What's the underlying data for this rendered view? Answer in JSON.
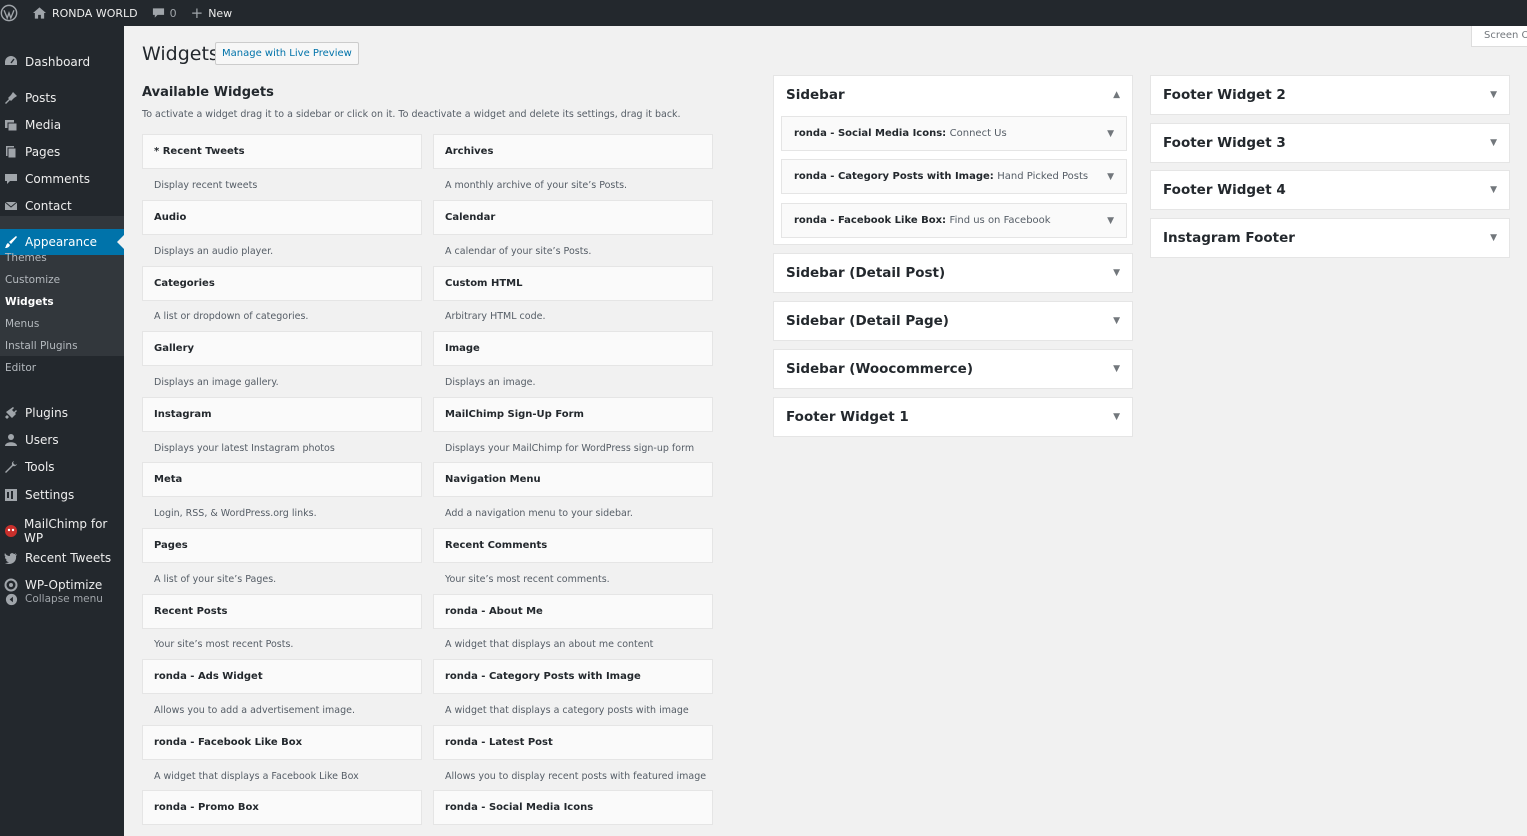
{
  "adminbar": {
    "site_name": "RONDA WORLD",
    "comments_count": "0",
    "new_label": "New",
    "screen_options": "Screen Options"
  },
  "menu": {
    "items": [
      {
        "label": "Dashboard",
        "icon": "dashboard-icon"
      },
      {
        "label": "Posts",
        "icon": "pin-icon"
      },
      {
        "label": "Media",
        "icon": "media-icon"
      },
      {
        "label": "Pages",
        "icon": "pages-icon"
      },
      {
        "label": "Comments",
        "icon": "comment-icon"
      },
      {
        "label": "Contact",
        "icon": "mail-icon"
      },
      {
        "label": "Appearance",
        "icon": "brush-icon"
      },
      {
        "label": "Plugins",
        "icon": "plug-icon"
      },
      {
        "label": "Users",
        "icon": "users-icon"
      },
      {
        "label": "Tools",
        "icon": "wrench-icon"
      },
      {
        "label": "Settings",
        "icon": "settings-icon"
      },
      {
        "label": "MailChimp for WP",
        "icon": "mailchimp-icon"
      },
      {
        "label": "Recent Tweets",
        "icon": "twitter-icon"
      },
      {
        "label": "WP-Optimize",
        "icon": "optimize-icon"
      }
    ],
    "submenu": [
      "Themes",
      "Customize",
      "Widgets",
      "Menus",
      "Install Plugins",
      "Editor"
    ],
    "collapse": "Collapse menu"
  },
  "page": {
    "title": "Widgets",
    "live_preview": "Manage with Live Preview",
    "available_title": "Available Widgets",
    "available_desc": "To activate a widget drag it to a sidebar or click on it. To deactivate a widget and delete its settings, drag it back."
  },
  "widgets": [
    {
      "name": "* Recent Tweets",
      "desc": "Display recent tweets"
    },
    {
      "name": "Archives",
      "desc": "A monthly archive of your site’s Posts."
    },
    {
      "name": "Audio",
      "desc": "Displays an audio player."
    },
    {
      "name": "Calendar",
      "desc": "A calendar of your site’s Posts."
    },
    {
      "name": "Categories",
      "desc": "A list or dropdown of categories."
    },
    {
      "name": "Custom HTML",
      "desc": "Arbitrary HTML code."
    },
    {
      "name": "Gallery",
      "desc": "Displays an image gallery."
    },
    {
      "name": "Image",
      "desc": "Displays an image."
    },
    {
      "name": "Instagram",
      "desc": "Displays your latest Instagram photos"
    },
    {
      "name": "MailChimp Sign-Up Form",
      "desc": "Displays your MailChimp for WordPress sign-up form"
    },
    {
      "name": "Meta",
      "desc": "Login, RSS, & WordPress.org links."
    },
    {
      "name": "Navigation Menu",
      "desc": "Add a navigation menu to your sidebar."
    },
    {
      "name": "Pages",
      "desc": "A list of your site’s Pages."
    },
    {
      "name": "Recent Comments",
      "desc": "Your site’s most recent comments."
    },
    {
      "name": "Recent Posts",
      "desc": "Your site’s most recent Posts."
    },
    {
      "name": "ronda - About Me",
      "desc": "A widget that displays an about me content"
    },
    {
      "name": "ronda - Ads Widget",
      "desc": "Allows you to add a advertisement image."
    },
    {
      "name": "ronda - Category Posts with Image",
      "desc": "A widget that displays a category posts with image"
    },
    {
      "name": "ronda - Facebook Like Box",
      "desc": "A widget that displays a Facebook Like Box"
    },
    {
      "name": "ronda - Latest Post",
      "desc": "Allows you to display recent posts with featured image"
    },
    {
      "name": "ronda - Promo Box",
      "desc": ""
    },
    {
      "name": "ronda - Social Media Icons",
      "desc": ""
    }
  ],
  "sidebars_col1": [
    {
      "title": "Sidebar",
      "open": true,
      "widgets": [
        {
          "name": "ronda - Social Media Icons:",
          "title": "Connect Us"
        },
        {
          "name": "ronda - Category Posts with Image:",
          "title": "Hand Picked Posts"
        },
        {
          "name": "ronda - Facebook Like Box:",
          "title": "Find us on Facebook"
        }
      ]
    },
    {
      "title": "Sidebar (Detail Post)"
    },
    {
      "title": "Sidebar (Detail Page)"
    },
    {
      "title": "Sidebar (Woocommerce)"
    },
    {
      "title": "Footer Widget 1"
    }
  ],
  "sidebars_col2": [
    {
      "title": "Footer Widget 2"
    },
    {
      "title": "Footer Widget 3"
    },
    {
      "title": "Footer Widget 4"
    },
    {
      "title": "Instagram Footer"
    }
  ],
  "icons": {
    "expand": "▼",
    "collapse": "▲"
  }
}
